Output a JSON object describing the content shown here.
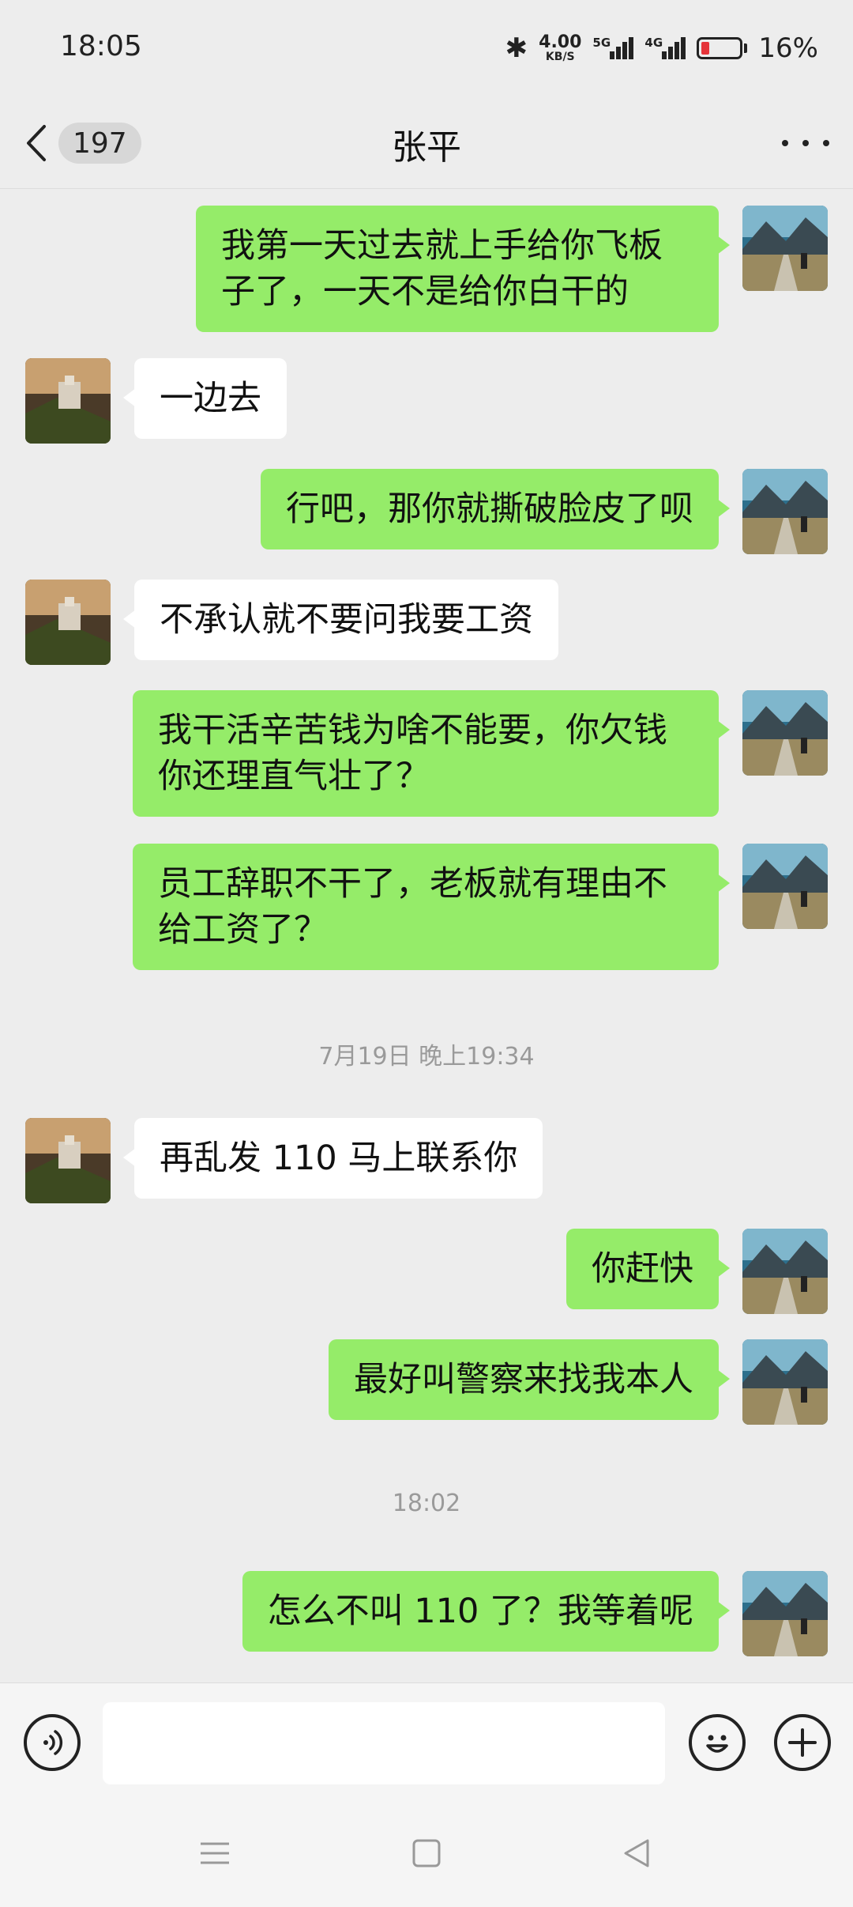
{
  "status": {
    "time": "18:05",
    "net_speed_value": "4.00",
    "net_speed_unit": "KB/S",
    "network_1": "5G",
    "network_2": "4G",
    "battery_percent": "16%",
    "battery_level": 0.16
  },
  "header": {
    "unread_count": "197",
    "title": "张平"
  },
  "colors": {
    "self_bubble": "#95ec69",
    "other_bubble": "#ffffff",
    "background": "#ededed",
    "battery_low": "#e5343a"
  },
  "messages": [
    {
      "from": "self",
      "text": "我第一天过去就上手给你飞板子了，一天不是给你白干的"
    },
    {
      "from": "other",
      "text": "一边去"
    },
    {
      "from": "self",
      "text": "行吧，那你就撕破脸皮了呗"
    },
    {
      "from": "other",
      "text": "不承认就不要问我要工资"
    },
    {
      "from": "self",
      "text": "我干活辛苦钱为啥不能要，你欠钱你还理直气壮了？"
    },
    {
      "from": "self",
      "text": "员工辞职不干了，老板就有理由不给工资了？"
    },
    {
      "from": "other",
      "text": "再乱发 110 马上联系你"
    },
    {
      "from": "self",
      "text": "你赶快"
    },
    {
      "from": "self",
      "text": "最好叫警察来找我本人"
    },
    {
      "from": "self",
      "text": "怎么不叫 110 了？我等着呢"
    }
  ],
  "timestamps": [
    "7月19日 晚上19:34",
    "18:02"
  ],
  "input": {
    "voice_icon": "voice-icon",
    "emoji_icon": "emoji-icon",
    "plus_icon": "plus-icon",
    "value": ""
  }
}
